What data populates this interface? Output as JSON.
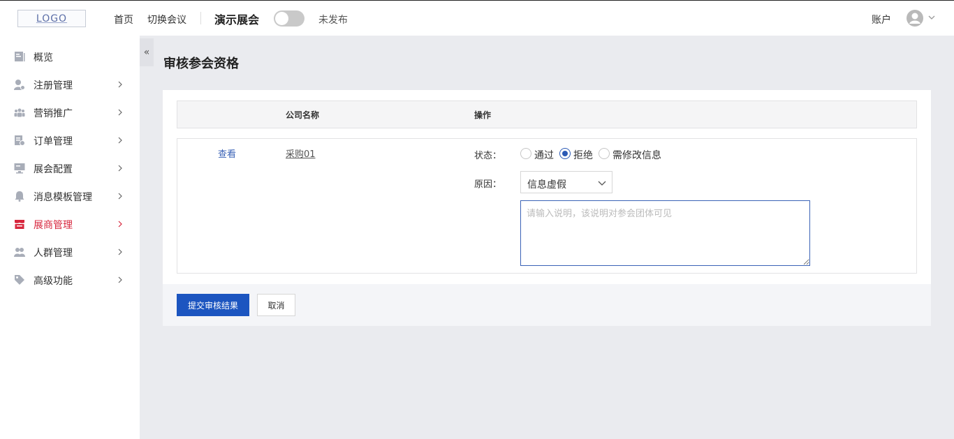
{
  "header": {
    "logo_text": "LOGO",
    "nav": {
      "home": "首页",
      "switch": "切换会议"
    },
    "event_name": "演示展会",
    "publish_status": "未发布",
    "account": "账户"
  },
  "sidebar": {
    "collapse_glyph": "«",
    "items": [
      {
        "label": "概览",
        "icon": "overview-icon",
        "has_children": false
      },
      {
        "label": "注册管理",
        "icon": "register-user-icon",
        "has_children": true
      },
      {
        "label": "营销推广",
        "icon": "users-group-icon",
        "has_children": true
      },
      {
        "label": "订单管理",
        "icon": "order-icon",
        "has_children": true
      },
      {
        "label": "展会配置",
        "icon": "monitor-icon",
        "has_children": true
      },
      {
        "label": "消息模板管理",
        "icon": "bell-icon",
        "has_children": true
      },
      {
        "label": "展商管理",
        "icon": "store-icon",
        "has_children": true,
        "active": true
      },
      {
        "label": "人群管理",
        "icon": "people-icon",
        "has_children": true
      },
      {
        "label": "高级功能",
        "icon": "tag-icon",
        "has_children": true
      }
    ]
  },
  "page": {
    "title": "审核参会资格",
    "table": {
      "headers": {
        "company": "公司名称",
        "action": "操作"
      },
      "row": {
        "view_link": "查看",
        "company": "采购01",
        "status_label": "状态：",
        "status_options": [
          "通过",
          "拒绝",
          "需修改信息"
        ],
        "status_selected": "拒绝",
        "reason_label": "原因：",
        "reason_value": "信息虚假",
        "note_placeholder": "请输入说明，该说明对参会团体可见"
      }
    }
  },
  "footer": {
    "submit_label": "提交审核结果",
    "cancel_label": "取消"
  },
  "colors": {
    "accent": "#1c55c0",
    "active_menu": "#d7263d",
    "link": "#3a62b6"
  }
}
